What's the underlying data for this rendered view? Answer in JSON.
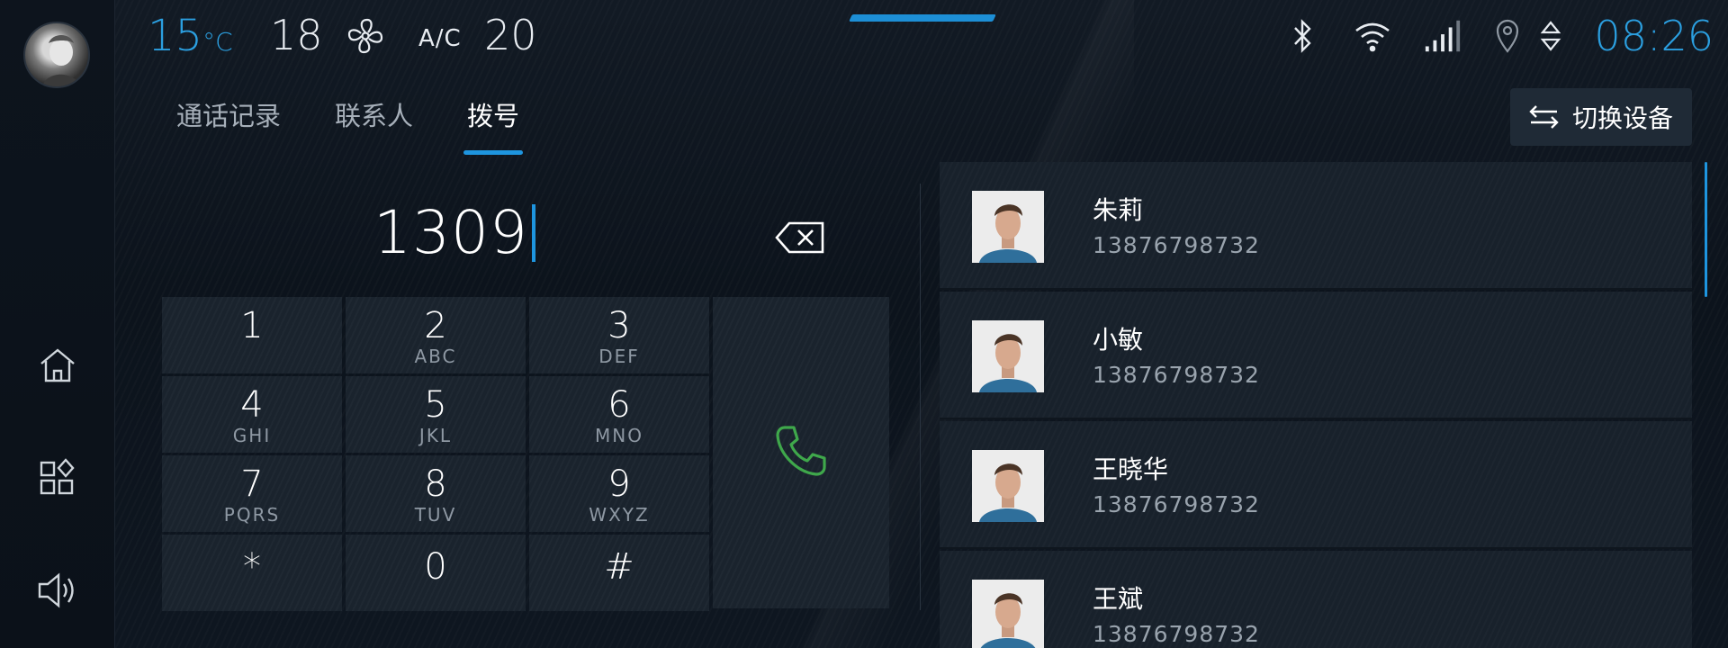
{
  "status_bar": {
    "temperature": "15",
    "temperature_unit": "°C",
    "fan_speed": "18",
    "ac_label": "A/C",
    "ac_temp": "20",
    "clock": "08:26",
    "icons": [
      "bluetooth-icon",
      "wifi-icon",
      "signal-icon",
      "location-icon",
      "sort-arrows-icon"
    ]
  },
  "rail": {
    "icons": [
      "avatar",
      "home-icon",
      "apps-icon",
      "volume-icon"
    ]
  },
  "tabs": [
    {
      "label": "通话记录",
      "active": false
    },
    {
      "label": "联系人",
      "active": false
    },
    {
      "label": "拨号",
      "active": true
    }
  ],
  "switch_device": {
    "label": "切换设备",
    "icon": "switch-arrows-icon"
  },
  "dialer": {
    "number": "1309",
    "keys": [
      {
        "digit": "1",
        "letters": ""
      },
      {
        "digit": "2",
        "letters": "ABC"
      },
      {
        "digit": "3",
        "letters": "DEF"
      },
      {
        "digit": "4",
        "letters": "GHI"
      },
      {
        "digit": "5",
        "letters": "JKL"
      },
      {
        "digit": "6",
        "letters": "MNO"
      },
      {
        "digit": "7",
        "letters": "PQRS"
      },
      {
        "digit": "8",
        "letters": "TUV"
      },
      {
        "digit": "9",
        "letters": "WXYZ"
      },
      {
        "digit": "*",
        "letters": ""
      },
      {
        "digit": "0",
        "letters": ""
      },
      {
        "digit": "#",
        "letters": ""
      }
    ],
    "call_icon": "phone-call-icon",
    "backspace_icon": "backspace-icon",
    "accent_color": "#1e95df",
    "call_color": "#3fa84b"
  },
  "contacts": [
    {
      "name": "朱莉",
      "number": "13876798732"
    },
    {
      "name": "小敏",
      "number": "13876798732"
    },
    {
      "name": "王晓华",
      "number": "13876798732"
    },
    {
      "name": "王斌",
      "number": "13876798732"
    }
  ]
}
